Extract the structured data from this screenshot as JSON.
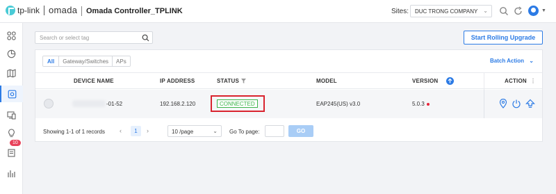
{
  "header": {
    "brand_primary": "tp-link",
    "brand_secondary": "omada",
    "title": "Omada Controller_TPLINK",
    "sites_label": "Sites:",
    "site_selected": "DUC TRONG COMPANY"
  },
  "sidebar": {
    "items": [
      {
        "icon": "dashboard-icon"
      },
      {
        "icon": "statistics-icon"
      },
      {
        "icon": "map-icon"
      },
      {
        "icon": "devices-icon",
        "active": true
      },
      {
        "icon": "clients-icon"
      },
      {
        "icon": "insight-icon"
      },
      {
        "icon": "log-icon",
        "badge": "10"
      },
      {
        "icon": "reports-icon"
      }
    ]
  },
  "toolbar": {
    "search_placeholder": "Search or select tag",
    "rolling_upgrade_label": "Start Rolling Upgrade"
  },
  "tabs": [
    {
      "label": "All",
      "active": true
    },
    {
      "label": "Gateway/Switches",
      "active": false
    },
    {
      "label": "APs",
      "active": false
    }
  ],
  "batch_action_label": "Batch Action",
  "table": {
    "columns": {
      "device_name": "DEVICE NAME",
      "ip_address": "IP ADDRESS",
      "status": "STATUS",
      "model": "MODEL",
      "version": "VERSION",
      "action": "ACTION"
    },
    "rows": [
      {
        "device_name": "-01-52",
        "ip_address": "192.168.2.120",
        "status": "CONNECTED",
        "model": "EAP245(US) v3.0",
        "version": "5.0.3"
      }
    ]
  },
  "pagination": {
    "summary": "Showing 1-1 of 1 records",
    "current_page": "1",
    "page_size": "10 /page",
    "goto_label": "Go To page:",
    "go_label": "GO"
  },
  "colors": {
    "accent": "#2c7be5",
    "connected": "#3bb54a",
    "highlight_border": "#d9232e",
    "badge": "#e8425a"
  }
}
